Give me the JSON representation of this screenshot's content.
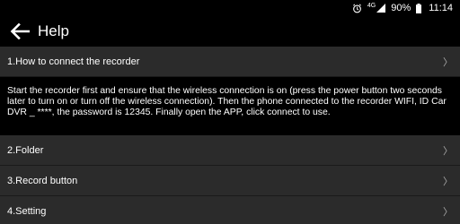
{
  "status_bar": {
    "network": "4G",
    "battery": "90%",
    "time": "11:14"
  },
  "app_bar": {
    "title": "Help"
  },
  "items": [
    {
      "label": "1.How to connect the recorder"
    },
    {
      "label": "2.Folder"
    },
    {
      "label": "3.Record button"
    },
    {
      "label": "4.Setting"
    }
  ],
  "answer_text": "Start the recorder first and ensure that the wireless connection is on (press the power button two seconds later to turn on or turn off the wireless connection). Then the phone connected to the recorder WIFI, ID Car DVR _ ****, the password is 12345. Finally open the APP, click connect to use."
}
